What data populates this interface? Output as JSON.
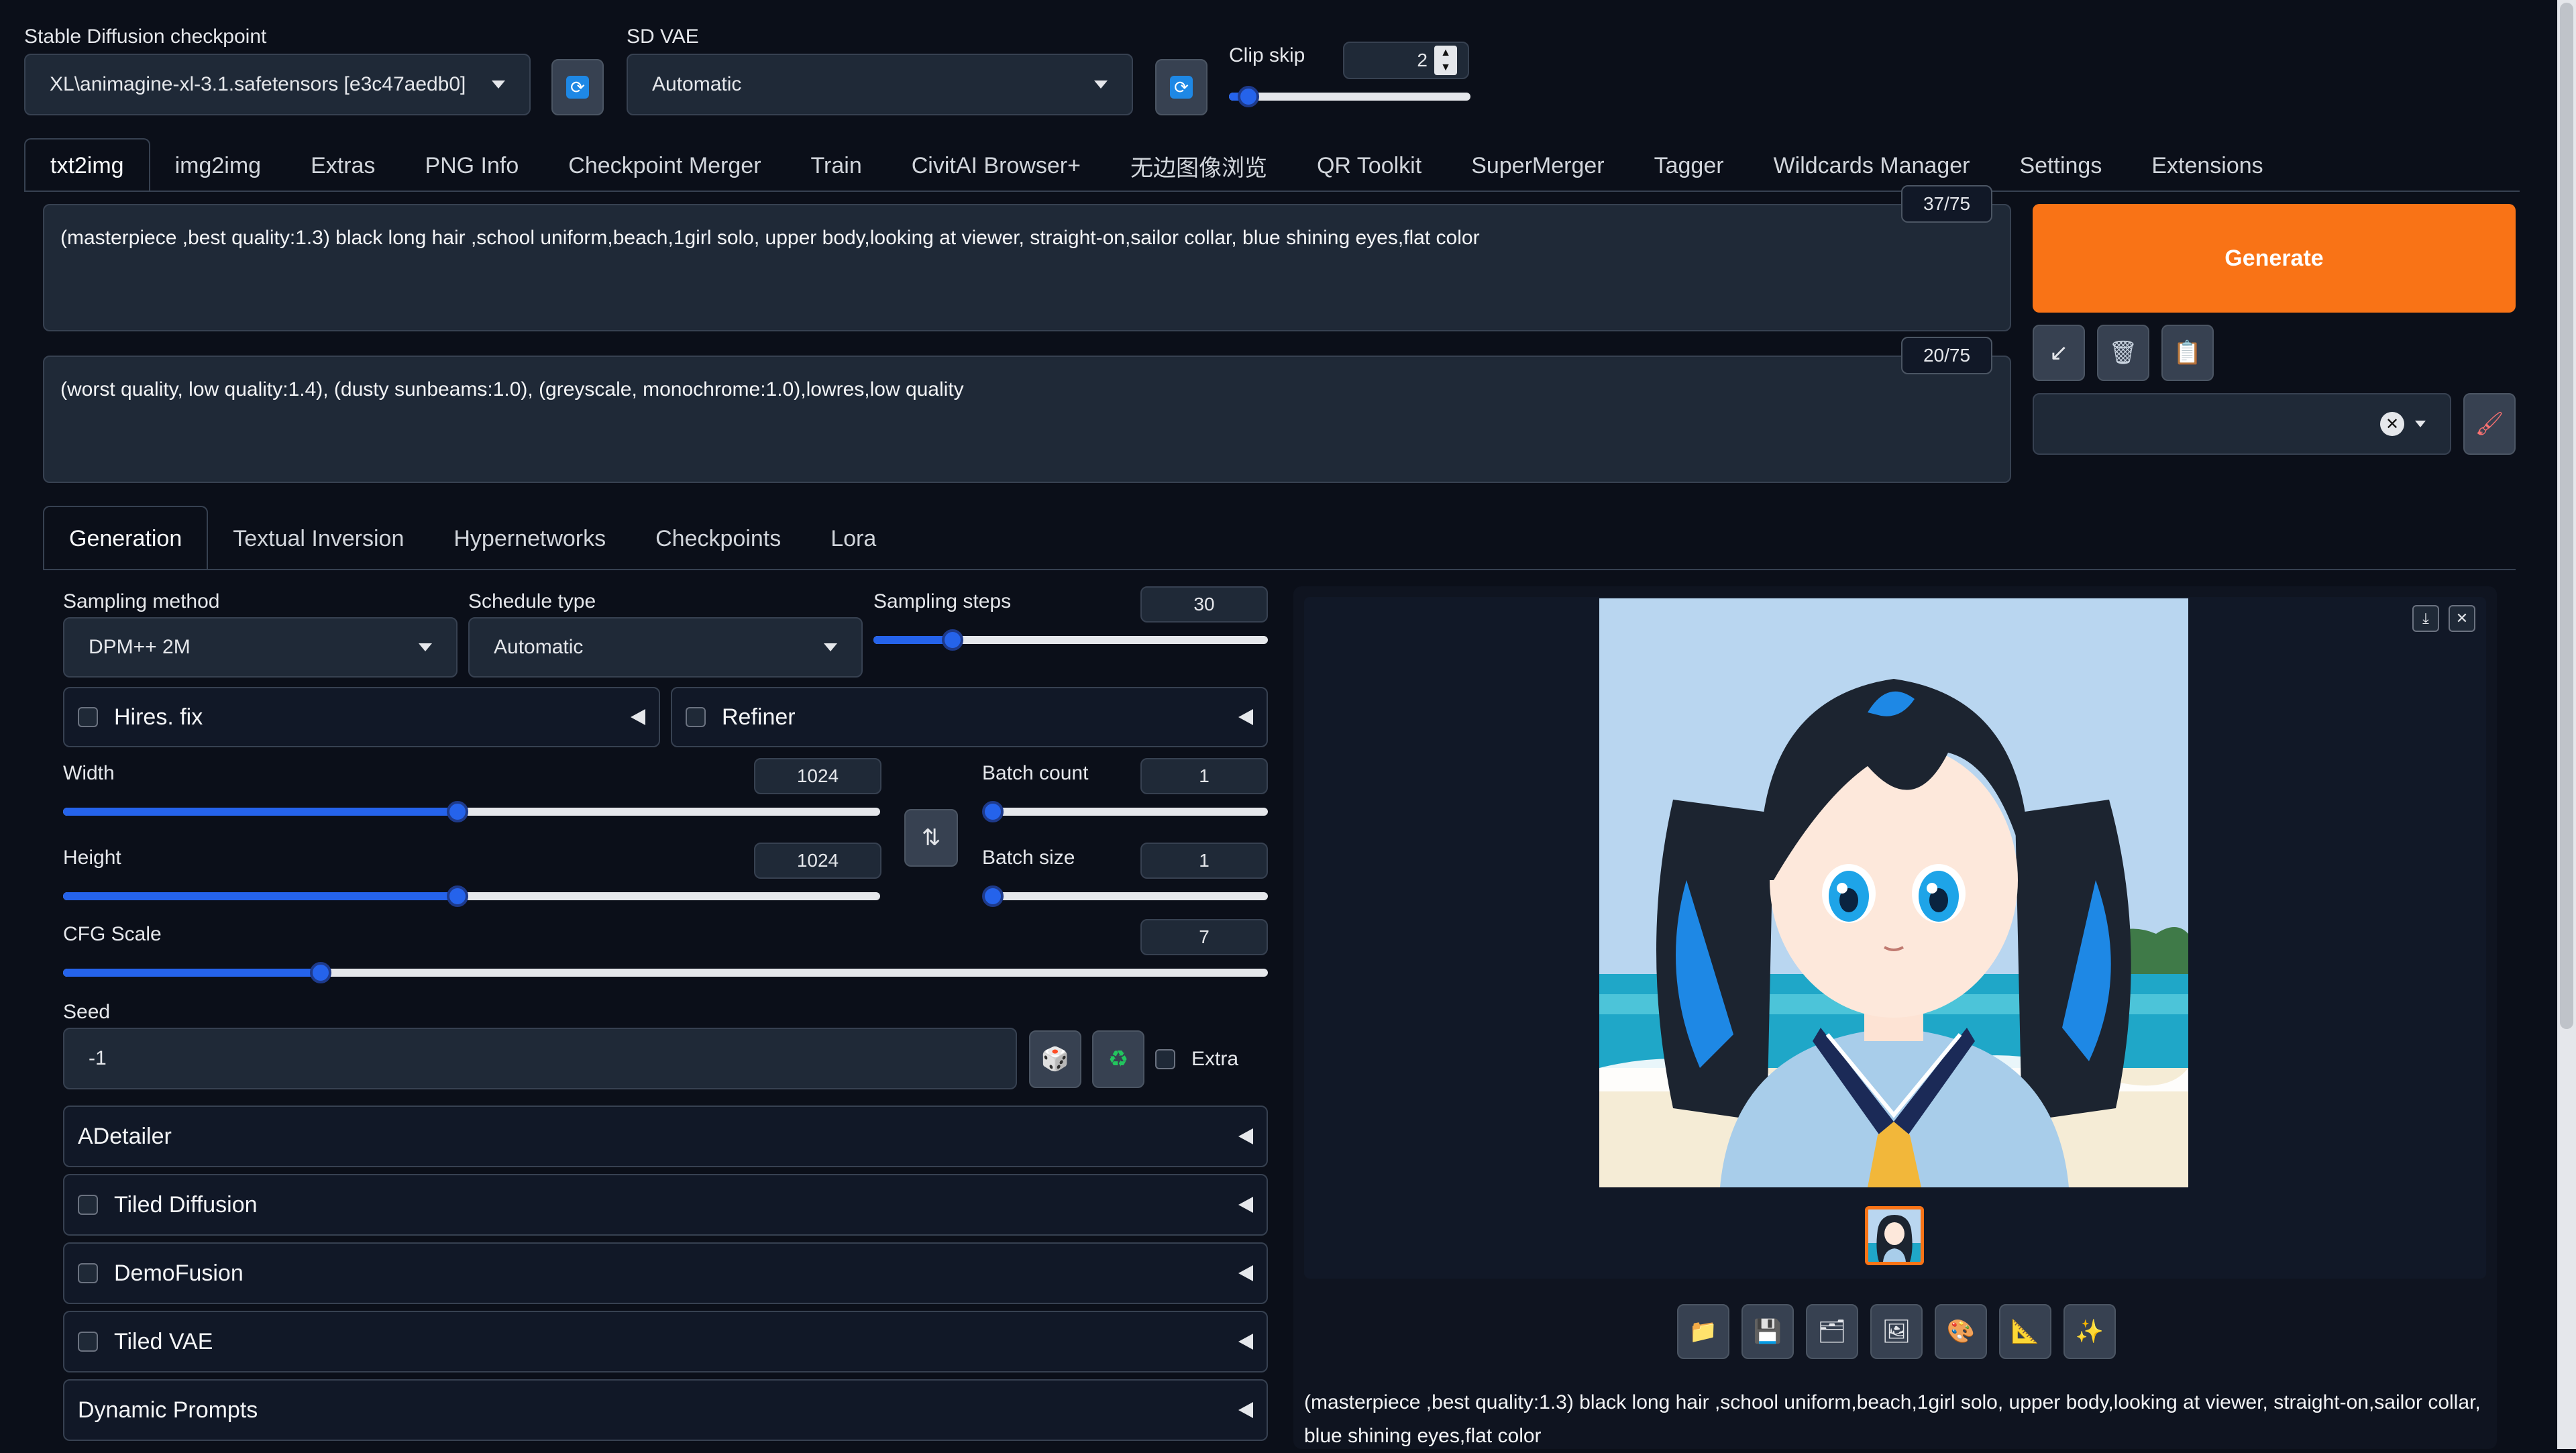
{
  "top": {
    "checkpoint_label": "Stable Diffusion checkpoint",
    "checkpoint_value": "XL\\animagine-xl-3.1.safetensors [e3c47aedb0]",
    "vae_label": "SD VAE",
    "vae_value": "Automatic",
    "clip_label": "Clip skip",
    "clip_value": "2",
    "clip_slider_fraction": 0.08
  },
  "tabs": [
    "txt2img",
    "img2img",
    "Extras",
    "PNG Info",
    "Checkpoint Merger",
    "Train",
    "CivitAI Browser+",
    "无边图像浏览",
    "QR Toolkit",
    "SuperMerger",
    "Tagger",
    "Wildcards Manager",
    "Settings",
    "Extensions"
  ],
  "prompt": {
    "positive": "(masterpiece ,best quality:1.3) black long hair ,school uniform,beach,1girl solo, upper body,looking at viewer, straight-on,sailor collar,  blue shining eyes,flat color",
    "positive_count": "37/75",
    "negative": "(worst quality, low quality:1.4), (dusty sunbeams:1.0), (greyscale, monochrome:1.0),lowres,low quality",
    "negative_count": "20/75"
  },
  "generate_label": "Generate",
  "subtabs": [
    "Generation",
    "Textual Inversion",
    "Hypernetworks",
    "Checkpoints",
    "Lora"
  ],
  "gen": {
    "sampling_method_label": "Sampling method",
    "sampling_method": "DPM++ 2M",
    "schedule_label": "Schedule type",
    "schedule": "Automatic",
    "steps_label": "Sampling steps",
    "steps": "30",
    "steps_fraction": 0.2,
    "hires": "Hires. fix",
    "refiner": "Refiner",
    "width_label": "Width",
    "width": "1024",
    "width_fraction": 0.483,
    "height_label": "Height",
    "height": "1024",
    "height_fraction": 0.483,
    "batch_count_label": "Batch count",
    "batch_count": "1",
    "batch_size_label": "Batch size",
    "batch_size": "1",
    "cfg_label": "CFG Scale",
    "cfg": "7",
    "cfg_fraction": 0.214,
    "seed_label": "Seed",
    "seed": "-1",
    "extra": "Extra"
  },
  "accordions": {
    "adetailer": "ADetailer",
    "tiled_diffusion": "Tiled Diffusion",
    "demofusion": "DemoFusion",
    "tiled_vae": "Tiled VAE",
    "dynamic_prompts": "Dynamic Prompts"
  },
  "output": {
    "caption": "(masterpiece ,best quality:1.3) black long hair ,school uniform,beach,1girl solo, upper body,looking at viewer, straight-on,sailor collar, blue shining eyes,flat color"
  },
  "colors": {
    "accent": "#f97316",
    "slider": "#2563eb",
    "background": "#0b0f19"
  }
}
